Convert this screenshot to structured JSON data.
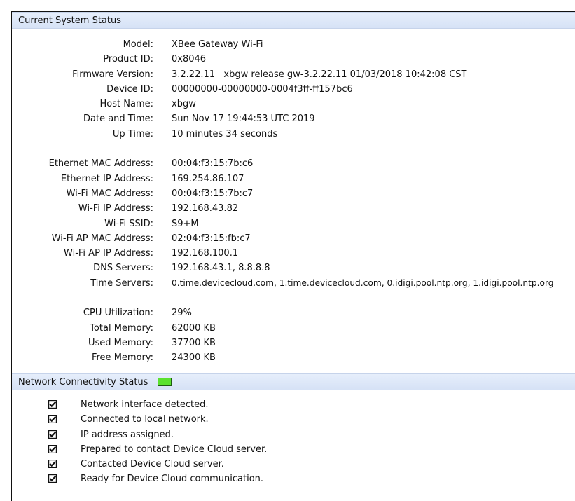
{
  "current_system_status": {
    "title": "Current System Status",
    "fields": [
      {
        "label": "Model:",
        "value": "XBee Gateway Wi-Fi"
      },
      {
        "label": "Product ID:",
        "value": "0x8046"
      },
      {
        "label": "Firmware Version:",
        "value": "3.2.22.11   xbgw release gw-3.2.22.11 01/03/2018 10:42:08 CST"
      },
      {
        "label": "Device ID:",
        "value": "00000000-00000000-0004f3ff-ff157bc6"
      },
      {
        "label": "Host Name:",
        "value": "xbgw"
      },
      {
        "label": "Date and Time:",
        "value": "Sun Nov 17 19:44:53 UTC 2019"
      },
      {
        "label": "Up Time:",
        "value": "10 minutes 34 seconds"
      },
      {
        "label": "Ethernet MAC Address:",
        "value": "00:04:f3:15:7b:c6"
      },
      {
        "label": "Ethernet IP Address:",
        "value": "169.254.86.107"
      },
      {
        "label": "Wi-Fi MAC Address:",
        "value": "00:04:f3:15:7b:c7"
      },
      {
        "label": "Wi-Fi IP Address:",
        "value": "192.168.43.82"
      },
      {
        "label": "Wi-Fi SSID:",
        "value": "S9+M"
      },
      {
        "label": "Wi-Fi AP MAC Address:",
        "value": "02:04:f3:15:fb:c7"
      },
      {
        "label": "Wi-Fi AP IP Address:",
        "value": "192.168.100.1"
      },
      {
        "label": "DNS Servers:",
        "value": "192.168.43.1, 8.8.8.8"
      },
      {
        "label": "Time Servers:",
        "value": "0.time.devicecloud.com, 1.time.devicecloud.com, 0.idigi.pool.ntp.org, 1.idigi.pool.ntp.org"
      },
      {
        "label": "CPU Utilization:",
        "value": "29%"
      },
      {
        "label": "Total Memory:",
        "value": "62000 KB"
      },
      {
        "label": "Used Memory:",
        "value": "37700 KB"
      },
      {
        "label": "Free Memory:",
        "value": "24300 KB"
      }
    ]
  },
  "network_connectivity_status": {
    "title": "Network Connectivity Status",
    "indicator_color": "#5be12e",
    "indicator_icon": "status-indicator-icon",
    "checklist_icon": "checkbox-checked-icon",
    "checklist": [
      {
        "label": "Network interface detected.",
        "checked": true
      },
      {
        "label": "Connected to local network.",
        "checked": true
      },
      {
        "label": "IP address assigned.",
        "checked": true
      },
      {
        "label": "Prepared to contact Device Cloud server.",
        "checked": true
      },
      {
        "label": "Contacted Device Cloud server.",
        "checked": true
      },
      {
        "label": "Ready for Device Cloud communication.",
        "checked": true
      }
    ]
  }
}
